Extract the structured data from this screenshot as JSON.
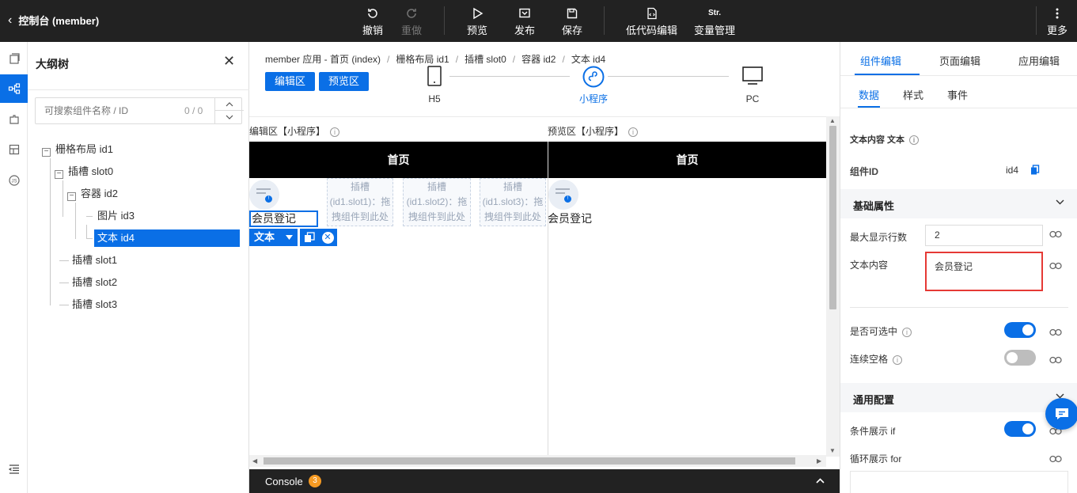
{
  "topbar": {
    "back_label": "控制台 (member)",
    "undo": "撤销",
    "redo": "重做",
    "preview": "预览",
    "publish": "发布",
    "save": "保存",
    "lowcode_edit": "低代码编辑",
    "var_mgmt": "变量管理",
    "var_icon_text": "Str.",
    "more": "更多"
  },
  "outline": {
    "title": "大纲树",
    "search_placeholder": "可搜索组件名称 / ID",
    "search_count": "0 / 0",
    "tree": {
      "n1": "栅格布局 id1",
      "n2": "插槽 slot0",
      "n3": "容器 id2",
      "n4": "图片 id3",
      "n5": "文本 id4",
      "n6": "插槽 slot1",
      "n7": "插槽 slot2",
      "n8": "插槽 slot3"
    }
  },
  "center": {
    "breadcrumb": {
      "b1": "member 应用 - 首页 (index)",
      "b2": "栅格布局 id1",
      "b3": "插槽 slot0",
      "b4": "容器 id2",
      "b5": "文本 id4"
    },
    "edit_btn": "编辑区",
    "preview_btn": "预览区",
    "devices": {
      "h5": "H5",
      "mini": "小程序",
      "pc": "PC"
    },
    "edit_header": "编辑区【小程序】",
    "preview_header": "预览区【小程序】",
    "navbar_title": "首页",
    "slots": {
      "s1": {
        "l1": "插槽",
        "l2": "(id1.slot1)：拖",
        "l3": "拽组件到此处"
      },
      "s2": {
        "l1": "插槽",
        "l2": "(id1.slot2)：拖",
        "l3": "拽组件到此处"
      },
      "s3": {
        "l1": "插槽",
        "l2": "(id1.slot3)：拖",
        "l3": "拽组件到此处"
      }
    },
    "text_content": "会员登记",
    "comp_type": "文本",
    "console_label": "Console",
    "console_count": "3"
  },
  "right": {
    "tabs": {
      "component": "组件编辑",
      "page": "页面编辑",
      "app": "应用编辑"
    },
    "subtabs": {
      "data": "数据",
      "style": "样式",
      "event": "事件"
    },
    "content_title": "文本内容 文本",
    "component_id_label": "组件ID",
    "component_id": "id4",
    "basic_section": "基础属性",
    "max_lines_label": "最大显示行数",
    "max_lines_value": "2",
    "text_label": "文本内容",
    "text_value": "会员登记",
    "selectable_label": "是否可选中",
    "selectable": true,
    "spaces_label": "连续空格",
    "spaces": false,
    "common_section": "通用配置",
    "if_label": "条件展示 if",
    "if_value": true,
    "for_label": "循环展示 for"
  },
  "colors": {
    "accent": "#0a6fe6",
    "topbar": "#222222",
    "highlight_border": "#e53935",
    "console_badge": "#f59a23"
  }
}
